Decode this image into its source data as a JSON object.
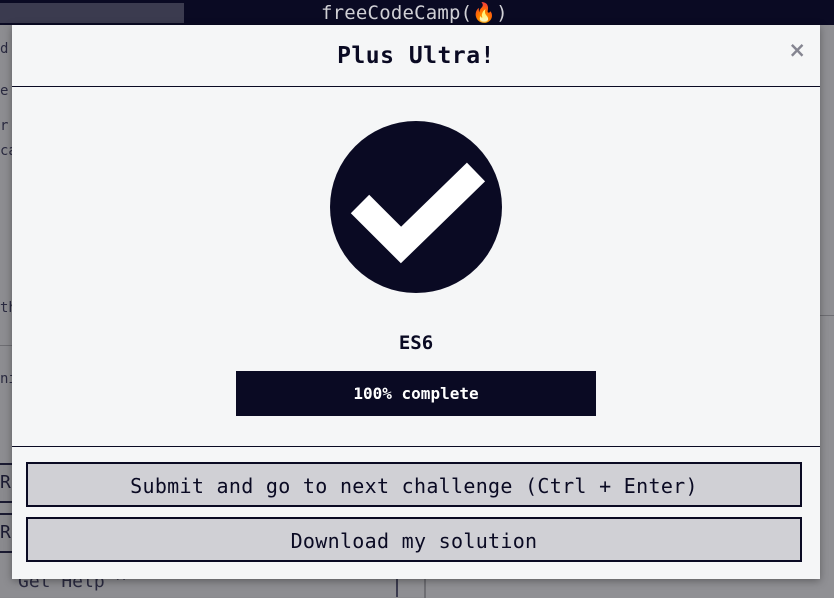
{
  "background": {
    "navbar": {
      "logo": "freeCodeCamp(🔥)"
    },
    "fragments": [
      "d",
      "e",
      "r",
      "ca",
      "th",
      "nis"
    ],
    "button_fragments": [
      "R",
      "Re"
    ],
    "get_help": "Get Help ⌃"
  },
  "modal": {
    "title": "Plus Ultra!",
    "close_glyph": "×",
    "block_name": "ES6",
    "progress": {
      "percent": 100,
      "label": "100% complete"
    },
    "buttons": {
      "submit_label": "Submit and go to next challenge (Ctrl + Enter)",
      "download_label": "Download my solution"
    }
  },
  "colors": {
    "primary_dark": "#0a0a23",
    "modal_bg": "#f5f6f7",
    "button_bg": "#d0d0d5",
    "close_gray": "#858591"
  },
  "icons": {
    "success": "checkmark-circle-icon",
    "logo_flame": "flame-icon"
  }
}
